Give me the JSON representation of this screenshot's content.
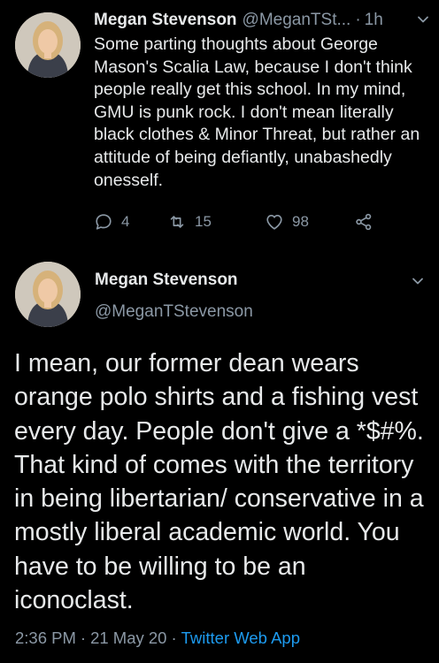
{
  "tweet1": {
    "name": "Megan Stevenson",
    "handle": "@MeganTSt...",
    "dot": "·",
    "time": "1h",
    "text": "Some parting thoughts about George Mason's Scalia Law, because I don't think people really get this school. In my mind, GMU is punk rock. I don't mean literally black clothes & Minor Threat, but rather an attitude of being defiantly, unabashedly onesself.",
    "replies": "4",
    "retweets": "15",
    "likes": "98"
  },
  "tweet2": {
    "name": "Megan Stevenson",
    "handle": "@MeganTStevenson",
    "text": "I mean, our former dean wears orange polo shirts and a fishing vest every day. People don't give a *$#%. That kind of comes with the territory in being libertarian/ conservative in a mostly liberal academic world. You have to be willing to be an iconoclast.",
    "time": "2:36 PM",
    "date": "21 May 20",
    "sep": "·",
    "app": "Twitter Web App"
  },
  "colors": {
    "background": "#000000",
    "text": "#e7e9ea",
    "secondary": "#8b98a5",
    "link": "#1d9bf0"
  },
  "icons": [
    "avatar-photo",
    "chevron-down-icon",
    "reply-icon",
    "retweet-icon",
    "like-icon",
    "share-icon"
  ]
}
